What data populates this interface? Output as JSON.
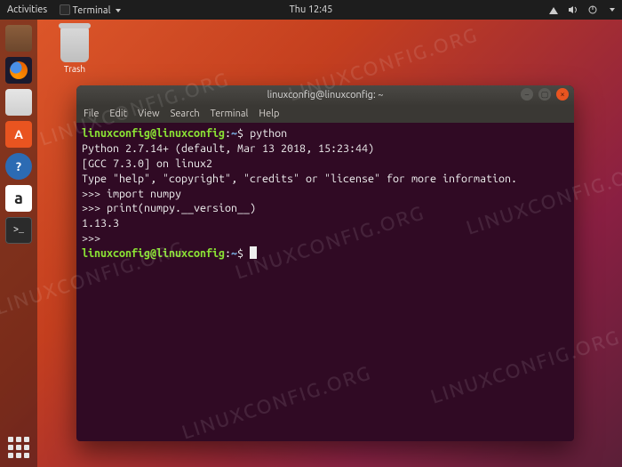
{
  "topbar": {
    "activities": "Activities",
    "app_indicator": "Terminal",
    "clock": "Thu 12:45"
  },
  "desktop": {
    "trash_label": "Trash"
  },
  "window": {
    "title": "linuxconfig@linuxconfig: ~",
    "menus": [
      "File",
      "Edit",
      "View",
      "Search",
      "Terminal",
      "Help"
    ]
  },
  "prompt": {
    "user_host": "linuxconfig@linuxconfig",
    "colon": ":",
    "path": "~",
    "sep": "$ "
  },
  "terminal": {
    "lines": [
      {
        "type": "prompt",
        "cmd": "python"
      },
      {
        "type": "out",
        "text": "Python 2.7.14+ (default, Mar 13 2018, 15:23:44)"
      },
      {
        "type": "out",
        "text": "[GCC 7.3.0] on linux2"
      },
      {
        "type": "out",
        "text": "Type \"help\", \"copyright\", \"credits\" or \"license\" for more information."
      },
      {
        "type": "py",
        "text": ">>> import numpy"
      },
      {
        "type": "py",
        "text": ">>> print(numpy.__version__)"
      },
      {
        "type": "out",
        "text": "1.13.3"
      },
      {
        "type": "py",
        "text": ">>> "
      },
      {
        "type": "prompt",
        "cmd": "",
        "cursor": true
      }
    ]
  },
  "watermark": "LINUXCONFIG.ORG"
}
